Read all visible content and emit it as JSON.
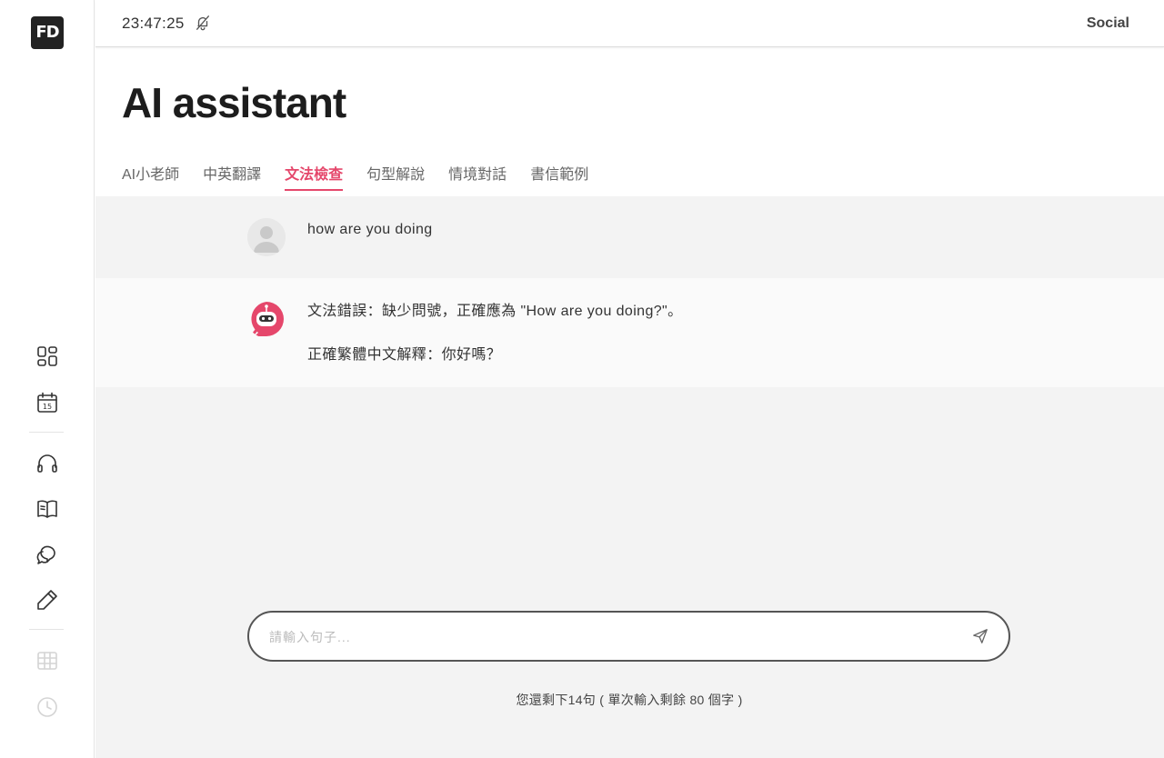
{
  "app": {
    "logo_text": "FD"
  },
  "topbar": {
    "time": "23:47:25",
    "social_label": "Social"
  },
  "page": {
    "title": "AI assistant"
  },
  "tabs": [
    {
      "label": "AI小老師"
    },
    {
      "label": "中英翻譯"
    },
    {
      "label": "文法檢查",
      "active": true
    },
    {
      "label": "句型解說"
    },
    {
      "label": "情境對話"
    },
    {
      "label": "書信範例"
    }
  ],
  "messages": {
    "user": {
      "text": "how are you doing"
    },
    "bot": {
      "line1": "文法錯誤：缺少問號，正確應為 \"How are you doing?\"。",
      "line2": "正確繁體中文解釋：你好嗎？"
    }
  },
  "input": {
    "placeholder": "請輸入句子...",
    "value": ""
  },
  "footer": {
    "remaining": "您還剩下14句 ( 單次輸入剩餘 80 個字 )"
  },
  "colors": {
    "accent": "#e5476b",
    "chat_bg": "#f3f3f3",
    "bot_row_bg": "#fafafa"
  },
  "icons": {
    "sidebar": [
      "dashboard-icon",
      "calendar-icon",
      "headphones-icon",
      "book-open-icon",
      "chat-bubbles-icon",
      "pencil-icon",
      "table-icon",
      "clock-icon"
    ],
    "topbar": [
      "bell-off-icon"
    ],
    "input": [
      "send-icon"
    ]
  }
}
